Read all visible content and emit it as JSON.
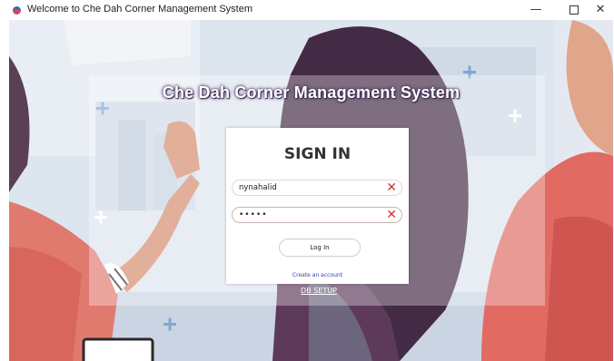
{
  "window": {
    "title": "Welcome to Che Dah Corner Management System",
    "icon": "app-logo-icon",
    "minimize_glyph": "—",
    "close_glyph": "✕"
  },
  "app": {
    "heading": "Che Dah Corner Management System"
  },
  "login": {
    "title": "SIGN IN",
    "username_value": "nynahalid",
    "password_value": "•••••",
    "clear_glyph": "✕",
    "login_label": "Log In",
    "create_account_label": "Create an account"
  },
  "footer": {
    "db_setup_label": "DB SETUP"
  },
  "colors": {
    "clear_icon": "#d63131",
    "link": "#2a3fbf",
    "heading_shadow": "#3b2b52"
  }
}
